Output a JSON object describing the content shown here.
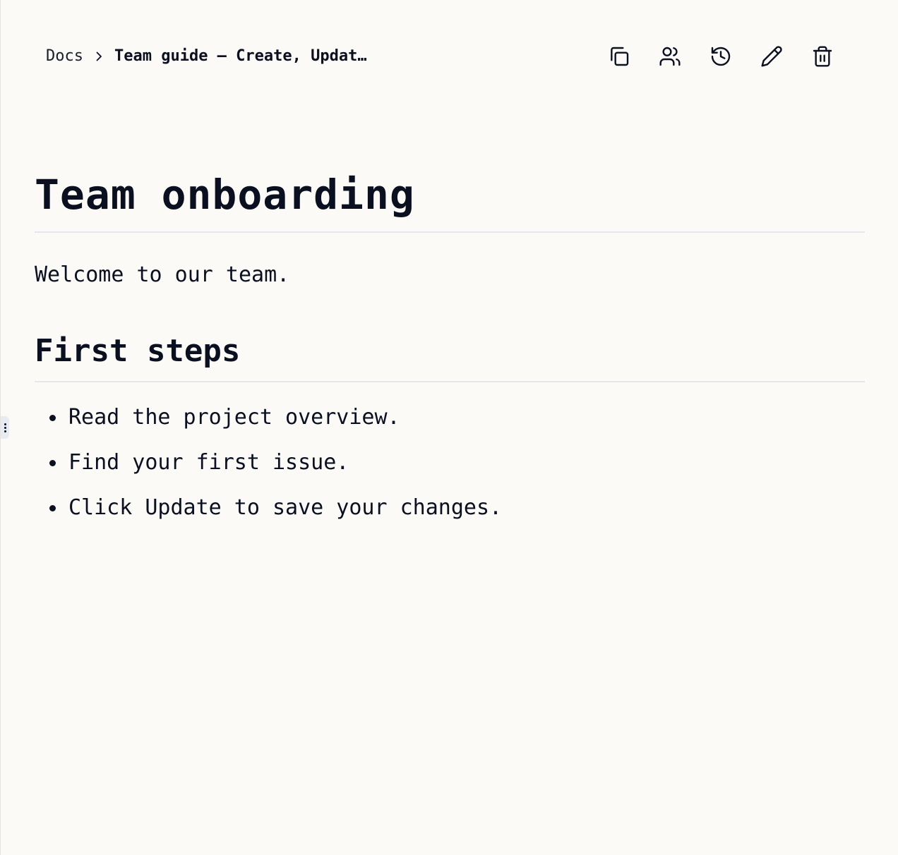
{
  "breadcrumb": {
    "root": "Docs",
    "separator_icon": "chevron-right-icon",
    "current": "Team guide — Create, Updat…"
  },
  "toolbar": {
    "buttons": [
      {
        "icon": "copy-icon"
      },
      {
        "icon": "users-icon"
      },
      {
        "icon": "history-icon"
      },
      {
        "icon": "pencil-icon"
      },
      {
        "icon": "trash-icon"
      }
    ]
  },
  "document": {
    "title": "Team onboarding",
    "intro": "Welcome to our team.",
    "section_heading": "First steps",
    "steps": [
      "Read the project overview.",
      "Find your first issue.",
      "Click Update to save your changes."
    ]
  },
  "colors": {
    "background": "#fbfaf7",
    "text": "#0a1020",
    "divider": "#e3e6ea"
  }
}
